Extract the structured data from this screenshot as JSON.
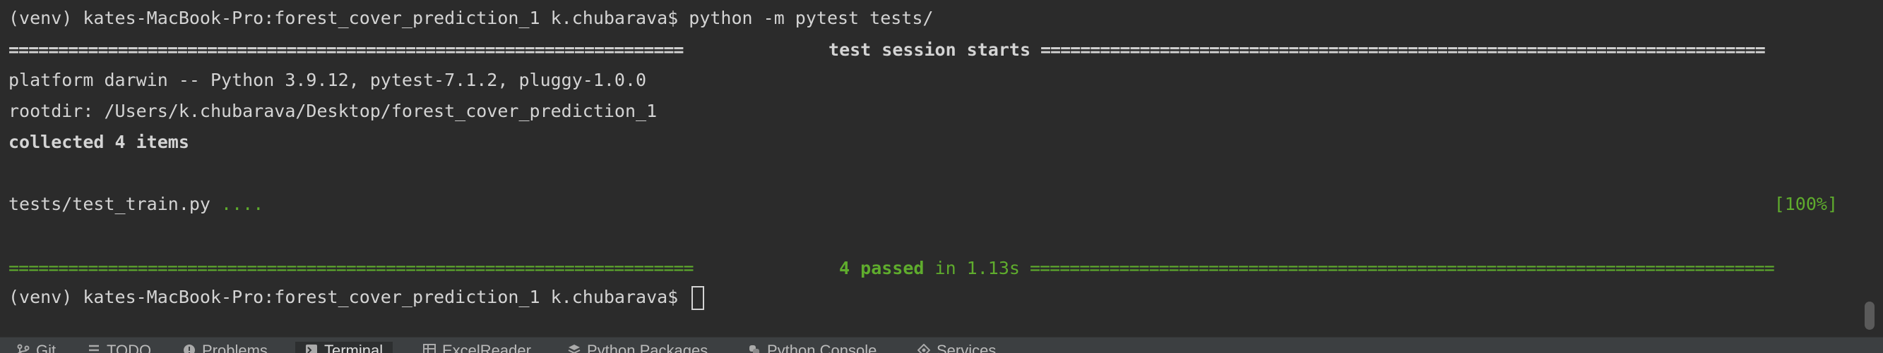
{
  "terminal": {
    "command_line": "(venv) kates-MacBook-Pro:forest_cover_prediction_1 k.chubarava$ python -m pytest tests/",
    "session_rule_left": "====================================================================",
    "session_rule_title": "test session starts",
    "session_rule_right": "=========================================================================",
    "platform_line": "platform darwin -- Python 3.9.12, pytest-7.1.2, pluggy-1.0.0",
    "rootdir_line": "rootdir: /Users/k.chubarava/Desktop/forest_cover_prediction_1",
    "collected_line": "collected 4 items",
    "test_file": "tests/test_train.py",
    "test_dots": "....",
    "test_percent": "[100%]",
    "summary_rule_left": "=====================================================================",
    "summary_passed": "4 passed",
    "summary_time": "in 1.13s",
    "summary_rule_right": "===========================================================================",
    "prompt_line": "(venv) kates-MacBook-Pro:forest_cover_prediction_1 k.chubarava$"
  },
  "toolbar": {
    "tabs": [
      {
        "label": "Git",
        "icon": "git-branch-icon"
      },
      {
        "label": "TODO",
        "icon": "list-icon"
      },
      {
        "label": "Problems",
        "icon": "problems-icon"
      },
      {
        "label": "Terminal",
        "icon": "terminal-icon",
        "active": true
      },
      {
        "label": "ExcelReader",
        "icon": "table-icon"
      },
      {
        "label": "Python Packages",
        "icon": "packages-icon"
      },
      {
        "label": "Python Console",
        "icon": "python-console-icon"
      },
      {
        "label": "Services",
        "icon": "services-icon"
      }
    ]
  },
  "colors": {
    "background": "#2b2b2b",
    "text": "#d4d4d4",
    "pass_green": "#5fac2d",
    "toolbar_bg": "#3c3f41"
  }
}
